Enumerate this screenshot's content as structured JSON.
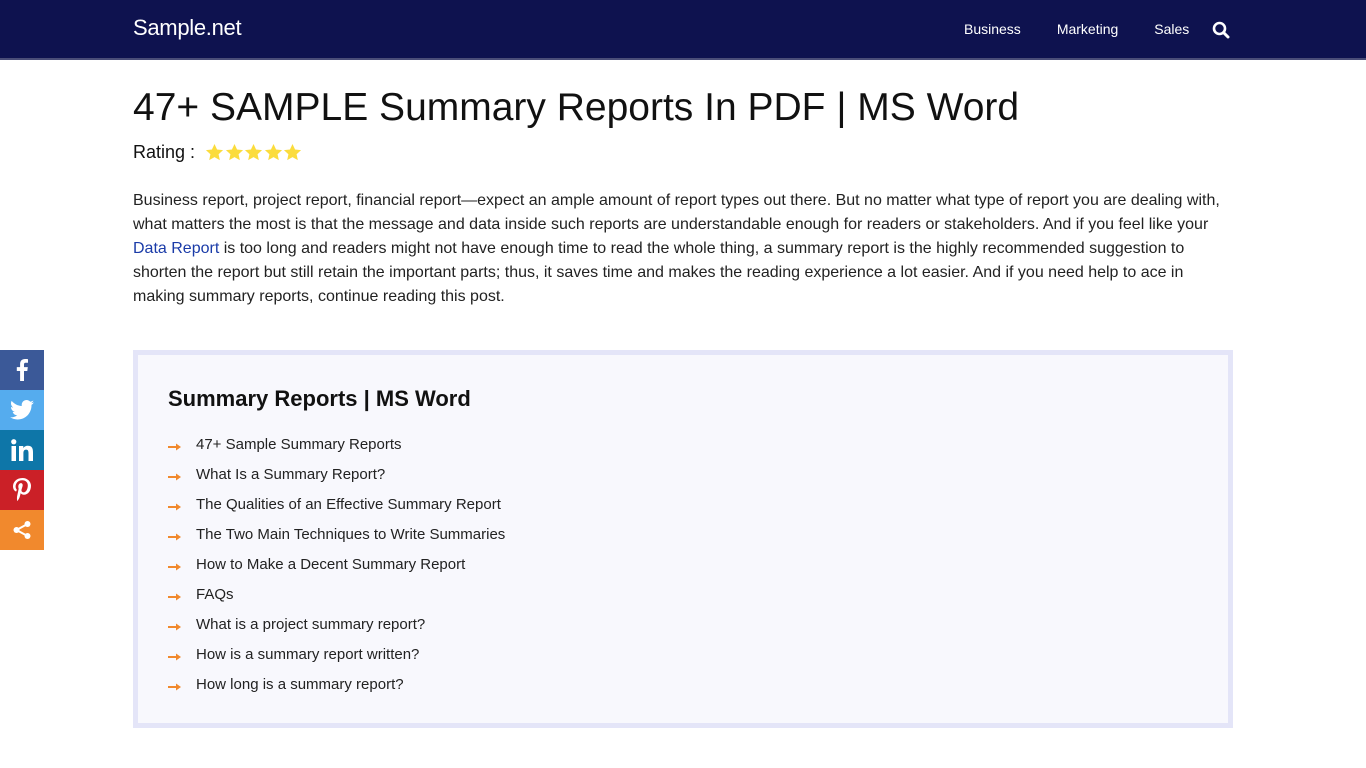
{
  "header": {
    "logo": "Sample.net",
    "nav": [
      {
        "label": "Business"
      },
      {
        "label": "Marketing"
      },
      {
        "label": "Sales"
      }
    ],
    "search_icon": "search-icon",
    "background": "#0e124f"
  },
  "article": {
    "title": "47+ SAMPLE Summary Reports In PDF | MS Word",
    "rating_label": "Rating :",
    "rating_value": 5,
    "rating_max": 5,
    "star_color": "#fbdc3c",
    "intro_part1": "Business report, project report, financial report—expect an ample amount of report types out there. But no matter what type of report you are dealing with, what matters the most is that the message and data inside such reports are understandable enough for readers or stakeholders. And if you feel like your ",
    "intro_link": "Data Report",
    "intro_part2": " is too long and readers might not have enough time to read the whole thing, a summary report is the highly recommended suggestion to shorten the report but still retain the important parts; thus, it saves time and makes the reading experience a lot easier. And if you need help to ace in making summary reports, continue reading this post."
  },
  "share": [
    {
      "name": "facebook",
      "icon": "facebook-icon",
      "color": "#3b5998"
    },
    {
      "name": "twitter",
      "icon": "twitter-icon",
      "color": "#55acee"
    },
    {
      "name": "linkedin",
      "icon": "linkedin-icon",
      "color": "#0e76a8"
    },
    {
      "name": "pinterest",
      "icon": "pinterest-icon",
      "color": "#cb2027"
    },
    {
      "name": "share",
      "icon": "share-icon",
      "color": "#f1892d"
    }
  ],
  "toc": {
    "title": "Summary Reports | MS Word",
    "arrow_color": "#f1892d",
    "items": [
      "47+ Sample Summary Reports",
      "What Is a Summary Report?",
      "The Qualities of an Effective Summary Report",
      "The Two Main Techniques to Write Summaries",
      "How to Make a Decent Summary Report",
      "FAQs",
      "What is a project summary report?",
      "How is a summary report written?",
      "How long is a summary report?"
    ]
  }
}
